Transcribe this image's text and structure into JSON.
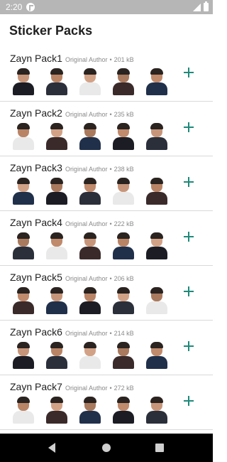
{
  "status_bar": {
    "time": "2:20",
    "icons": [
      "app-notification-icon",
      "signal-icon",
      "battery-icon"
    ]
  },
  "app_title": "Sticker Packs",
  "packs": [
    {
      "name": "Zayn Pack1",
      "author": "Original Author",
      "separator": "•",
      "size": "201 kB"
    },
    {
      "name": "Zayn Pack2",
      "author": "Original Author",
      "separator": "•",
      "size": "235 kB"
    },
    {
      "name": "Zayn Pack3",
      "author": "Original Author",
      "separator": "•",
      "size": "238 kB"
    },
    {
      "name": "Zayn Pack4",
      "author": "Original Author",
      "separator": "•",
      "size": "222 kB"
    },
    {
      "name": "Zayn Pack5",
      "author": "Original Author",
      "separator": "•",
      "size": "206 kB"
    },
    {
      "name": "Zayn Pack6",
      "author": "Original Author",
      "separator": "•",
      "size": "214 kB"
    },
    {
      "name": "Zayn Pack7",
      "author": "Original Author",
      "separator": "•",
      "size": "272 kB"
    }
  ],
  "colors": {
    "accent": "#1f8a7a",
    "status_bar": "#b6b6b6",
    "nav_bar": "#000000",
    "divider": "#d9d9d9"
  },
  "nav_bar": {
    "icons": [
      "back-icon",
      "home-icon",
      "recent-apps-icon"
    ]
  }
}
